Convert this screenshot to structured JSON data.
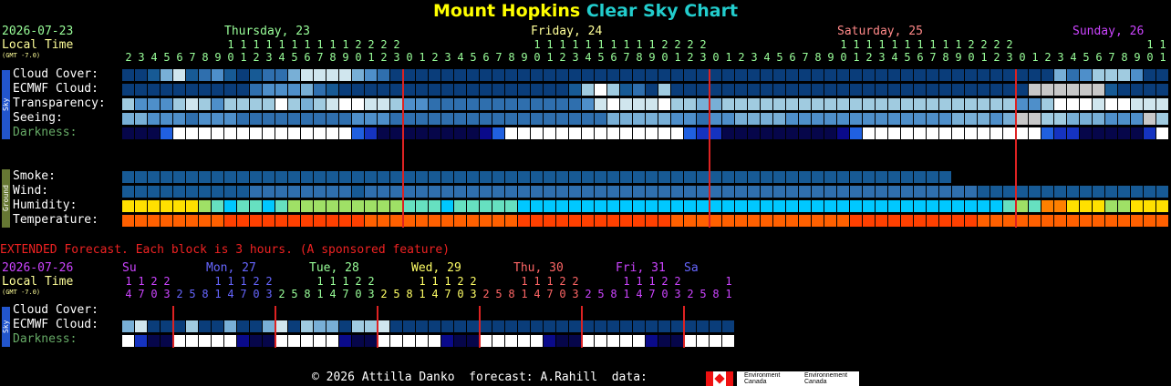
{
  "title": {
    "place": "Mount Hopkins",
    "chart": "Clear Sky Chart"
  },
  "header": {
    "date": "2026-07-23",
    "local_time_label": "Local Time",
    "gmt_note": "(GMT -7.0)",
    "days": [
      {
        "label": "Thursday, 23",
        "color": "#9f9"
      },
      {
        "label": "Friday, 24",
        "color": "#ff9"
      },
      {
        "label": "Saturday, 25",
        "color": "#f88"
      },
      {
        "label": "Sunday, 26",
        "color": "#c4f"
      }
    ],
    "hours": [
      "2",
      "3",
      "4",
      "5",
      "6",
      "7",
      "8",
      "9",
      "10",
      "11",
      "12",
      "13",
      "14",
      "15",
      "16",
      "17",
      "18",
      "19",
      "20",
      "21",
      "22",
      "23",
      "0",
      "1",
      "2",
      "3",
      "4",
      "5",
      "6",
      "7",
      "8",
      "9",
      "10",
      "11",
      "12",
      "13",
      "14",
      "15",
      "16",
      "17",
      "18",
      "19",
      "20",
      "21",
      "22",
      "23",
      "0",
      "1",
      "2",
      "3",
      "4",
      "5",
      "6",
      "7",
      "8",
      "9",
      "10",
      "11",
      "12",
      "13",
      "14",
      "15",
      "16",
      "17",
      "18",
      "19",
      "20",
      "21",
      "22",
      "23",
      "0",
      "1",
      "2",
      "3",
      "4",
      "5",
      "6",
      "7",
      "8",
      "9",
      "10",
      "11",
      "12",
      "13",
      "14",
      "15",
      "16",
      "17",
      "18",
      "19",
      "20",
      "21",
      "22",
      "23",
      "0",
      "1",
      "2",
      "3",
      "4",
      "5",
      "6",
      "7",
      "8",
      "9",
      "10",
      "11"
    ]
  },
  "sky_rows": [
    "Cloud Cover:",
    "ECMWF Cloud:",
    "Transparency:",
    "Seeing:",
    "Darkness:"
  ],
  "ground_rows": [
    "Smoke:",
    "Wind:",
    "Humidity:",
    "Temperature:"
  ],
  "tags": {
    "sky": "Sky",
    "ground": "Ground"
  },
  "extended": {
    "note": "EXTENDED Forecast. Each block is 3 hours. (A sponsored feature)",
    "date": "2026-07-26",
    "local_time_label": "Local Time",
    "gmt_note": "(GMT -7.0)",
    "days": [
      {
        "label": "Su",
        "color": "#c4f"
      },
      {
        "label": "Mon, 27",
        "color": "#66f"
      },
      {
        "label": "Tue, 28",
        "color": "#9f9"
      },
      {
        "label": "Wed, 29",
        "color": "#ff6"
      },
      {
        "label": "Thu, 30",
        "color": "#f66"
      },
      {
        "label": "Fri, 31",
        "color": "#c4f"
      },
      {
        "label": "Sa",
        "color": "#66f"
      }
    ],
    "hours": [
      "14",
      "17",
      "20",
      "23",
      "2",
      "5",
      "8",
      "11",
      "14",
      "17",
      "20",
      "23",
      "2",
      "5",
      "8",
      "11",
      "14",
      "17",
      "20",
      "23",
      "2",
      "5",
      "8",
      "11",
      "14",
      "17",
      "20",
      "23",
      "2",
      "5",
      "8",
      "11",
      "14",
      "17",
      "20",
      "23",
      "2",
      "5",
      "8",
      "11",
      "14",
      "17",
      "20",
      "23",
      "2",
      "5",
      "8",
      "11"
    ],
    "rows": [
      "Cloud Cover:",
      "ECMWF Cloud:",
      "Darkness:"
    ]
  },
  "footer": {
    "text": "© 2026 Attilla Danko  forecast: A.Rahill  data:",
    "logo_text_1": "Environment Canada",
    "logo_text_2": "Environnement Canada"
  },
  "chart_data": {
    "type": "heatmap",
    "title": "Mount Hopkins Clear Sky Chart",
    "x_hours_start": "2026-07-23 02:00",
    "hourly_blocks": 82,
    "palette": {
      "cloud": [
        "#0a3d7a",
        "#175a95",
        "#2f6fae",
        "#4e8fca",
        "#78afd6",
        "#a0cbe0",
        "#d0e6ee",
        "#ffffff"
      ],
      "ecmwf_flag": "#c8c8c8",
      "darkness_dark": "#0a0a8a",
      "darkness_day": "#ffffff",
      "humidity": [
        "#00c8ff",
        "#66e0c0",
        "#9fe066",
        "#ffe000",
        "#ff8000"
      ],
      "temperature": [
        "#ff4000",
        "#ff6000"
      ]
    },
    "series": [
      {
        "name": "Cloud Cover",
        "values": [
          0,
          0,
          1,
          4,
          6,
          1,
          2,
          3,
          1,
          0,
          1,
          2,
          2,
          4,
          6,
          6,
          6,
          6,
          4,
          3,
          2,
          0,
          0,
          0,
          0,
          0,
          0,
          0,
          0,
          0,
          0,
          0,
          0,
          0,
          0,
          0,
          0,
          0,
          0,
          0,
          0,
          0,
          0,
          0,
          0,
          0,
          0,
          0,
          0,
          0,
          0,
          0,
          0,
          0,
          0,
          0,
          0,
          0,
          0,
          0,
          0,
          0,
          0,
          0,
          0,
          0,
          0,
          0,
          0,
          0,
          0,
          0,
          0,
          4,
          2,
          3,
          5,
          5,
          5,
          3,
          0,
          0
        ]
      },
      {
        "name": "ECMWF Cloud",
        "values": [
          0,
          0,
          0,
          0,
          0,
          0,
          0,
          0,
          0,
          0,
          2,
          3,
          3,
          3,
          4,
          2,
          1,
          0,
          0,
          0,
          0,
          0,
          0,
          0,
          0,
          0,
          0,
          0,
          0,
          0,
          0,
          0,
          0,
          0,
          0,
          1,
          5,
          7,
          5,
          1,
          2,
          0,
          5,
          0,
          0,
          0,
          0,
          0,
          0,
          0,
          0,
          0,
          0,
          0,
          0,
          0,
          0,
          0,
          0,
          0,
          0,
          0,
          0,
          0,
          0,
          0,
          0,
          0,
          0,
          0,
          0,
          8,
          8,
          8,
          8,
          8,
          8,
          1,
          0,
          0,
          0,
          0
        ]
      },
      {
        "name": "Transparency",
        "values": [
          5,
          3,
          3,
          3,
          5,
          6,
          5,
          3,
          5,
          5,
          5,
          5,
          7,
          5,
          4,
          5,
          6,
          7,
          7,
          6,
          6,
          5,
          3,
          3,
          2,
          2,
          2,
          2,
          2,
          2,
          2,
          2,
          2,
          2,
          2,
          2,
          3,
          6,
          7,
          6,
          6,
          6,
          7,
          5,
          5,
          4,
          4,
          5,
          5,
          5,
          5,
          5,
          5,
          5,
          5,
          5,
          5,
          5,
          5,
          5,
          5,
          5,
          5,
          5,
          5,
          5,
          5,
          5,
          5,
          5,
          3,
          3,
          5,
          7,
          7,
          7,
          6,
          7,
          7,
          6,
          6,
          6
        ]
      },
      {
        "name": "Seeing",
        "values": [
          4,
          4,
          3,
          3,
          3,
          2,
          3,
          3,
          3,
          2,
          2,
          2,
          2,
          2,
          2,
          2,
          2,
          2,
          3,
          3,
          3,
          2,
          2,
          2,
          2,
          2,
          2,
          2,
          2,
          2,
          2,
          2,
          2,
          2,
          2,
          2,
          2,
          2,
          4,
          4,
          4,
          4,
          4,
          3,
          3,
          2,
          3,
          3,
          4,
          4,
          4,
          4,
          3,
          3,
          3,
          3,
          3,
          3,
          3,
          3,
          3,
          3,
          3,
          3,
          3,
          4,
          4,
          4,
          3,
          4,
          6,
          6,
          5,
          5,
          4,
          4,
          4,
          3,
          3,
          3,
          6,
          5
        ]
      },
      {
        "name": "Darkness",
        "values": [
          1,
          1,
          1,
          4,
          8,
          9,
          9,
          9,
          9,
          9,
          9,
          9,
          9,
          9,
          9,
          9,
          9,
          9,
          4,
          3,
          1,
          1,
          1,
          1,
          1,
          1,
          1,
          1,
          2,
          4,
          9,
          9,
          9,
          9,
          9,
          9,
          9,
          9,
          9,
          9,
          9,
          9,
          9,
          9,
          4,
          3,
          3,
          1,
          1,
          1,
          1,
          1,
          1,
          1,
          1,
          1,
          2,
          4,
          9,
          9,
          9,
          9,
          9,
          9,
          9,
          9,
          9,
          9,
          9,
          9,
          9,
          9,
          4,
          3,
          3,
          1,
          1,
          1,
          1,
          1,
          3,
          9
        ]
      },
      {
        "name": "Smoke",
        "values": [
          0,
          0,
          0,
          0,
          0,
          0,
          0,
          0,
          0,
          0,
          0,
          0,
          0,
          0,
          0,
          0,
          0,
          0,
          0,
          0,
          0,
          0,
          0,
          0,
          0,
          0,
          0,
          0,
          0,
          0,
          0,
          0,
          0,
          0,
          0,
          0,
          0,
          0,
          0,
          0,
          0,
          0,
          0,
          0,
          0,
          0,
          0,
          0,
          0,
          0,
          0,
          0,
          0,
          0,
          0,
          0,
          0,
          0,
          0,
          0,
          0,
          0,
          0,
          0,
          0
        ]
      },
      {
        "name": "Wind",
        "values": [
          1,
          1,
          1,
          1,
          1,
          1,
          1,
          1,
          1,
          1,
          2,
          2,
          2,
          2,
          2,
          2,
          2,
          2,
          1,
          2,
          2,
          2,
          2,
          2,
          2,
          2,
          2,
          2,
          2,
          2,
          2,
          2,
          2,
          2,
          2,
          2,
          2,
          2,
          2,
          2,
          2,
          2,
          2,
          2,
          2,
          2,
          2,
          2,
          2,
          2,
          2,
          2,
          2,
          2,
          2,
          2,
          2,
          2,
          2,
          2,
          2,
          2,
          2,
          2,
          2,
          2,
          2,
          1,
          1,
          1,
          1,
          1,
          1,
          1,
          1,
          1,
          1,
          1,
          1,
          1,
          1,
          1
        ]
      },
      {
        "name": "Humidity",
        "values": [
          3,
          3,
          3,
          3,
          3,
          3,
          2,
          1,
          0,
          1,
          1,
          0,
          1,
          2,
          2,
          2,
          2,
          2,
          2,
          2,
          2,
          2,
          1,
          1,
          1,
          0,
          1,
          1,
          1,
          1,
          1,
          0,
          0,
          0,
          0,
          0,
          0,
          0,
          0,
          0,
          0,
          0,
          0,
          0,
          0,
          0,
          0,
          0,
          0,
          0,
          0,
          0,
          0,
          0,
          0,
          0,
          0,
          0,
          0,
          0,
          0,
          0,
          0,
          0,
          0,
          0,
          0,
          0,
          0,
          1,
          2,
          1,
          4,
          4,
          3,
          3,
          3,
          2,
          2,
          3,
          3,
          3,
          4,
          4,
          3,
          3,
          3,
          2,
          1
        ]
      },
      {
        "name": "Temperature",
        "values": [
          1,
          1,
          1,
          1,
          1,
          1,
          1,
          1,
          0,
          0,
          0,
          0,
          0,
          0,
          0,
          0,
          0,
          0,
          0,
          1,
          1,
          1,
          1,
          1,
          1,
          1,
          1,
          1,
          1,
          1,
          1,
          0,
          0,
          0,
          0,
          0,
          0,
          0,
          0,
          0,
          0,
          0,
          0,
          1,
          1,
          1,
          1,
          1,
          1,
          1,
          1,
          1,
          1,
          1,
          1,
          1,
          1,
          0,
          0,
          0,
          0,
          0,
          0,
          0,
          0,
          0,
          0,
          1,
          1,
          1,
          1,
          1,
          1,
          1,
          1,
          1,
          1,
          1,
          1,
          1,
          1,
          1
        ]
      },
      {
        "name": "Extended Cloud Cover",
        "values": [
          5,
          6,
          0,
          0,
          0,
          5,
          0,
          0,
          4,
          0,
          0,
          4,
          6,
          0,
          5,
          4,
          4,
          0,
          5,
          5,
          6,
          0,
          0,
          0,
          0,
          0,
          0,
          0,
          0,
          0,
          0,
          0,
          0,
          0,
          0,
          0,
          0,
          0,
          0,
          0,
          0,
          0,
          0,
          0,
          0,
          0,
          0,
          0
        ]
      },
      {
        "name": "Extended ECMWF Cloud",
        "values": [
          4,
          6,
          0,
          0,
          0,
          5,
          0,
          0,
          4,
          0,
          0,
          4,
          6,
          0,
          5,
          4,
          4,
          0,
          5,
          5,
          6,
          0,
          0,
          0,
          0,
          0,
          0,
          0,
          0,
          0,
          0,
          0,
          0,
          0,
          0,
          0,
          0,
          0,
          0,
          0,
          0,
          0,
          0,
          0,
          0,
          0,
          0,
          0
        ]
      },
      {
        "name": "Extended Darkness",
        "values": [
          9,
          3,
          1,
          1,
          9,
          9,
          9,
          9,
          9,
          2,
          1,
          1,
          9,
          9,
          9,
          9,
          9,
          2,
          1,
          1,
          9,
          9,
          9,
          9,
          9,
          2,
          1,
          1,
          9,
          9,
          9,
          9,
          9,
          2,
          1,
          1,
          9,
          9,
          9,
          9,
          9,
          2,
          1,
          1,
          9,
          9,
          9,
          9
        ]
      }
    ]
  }
}
